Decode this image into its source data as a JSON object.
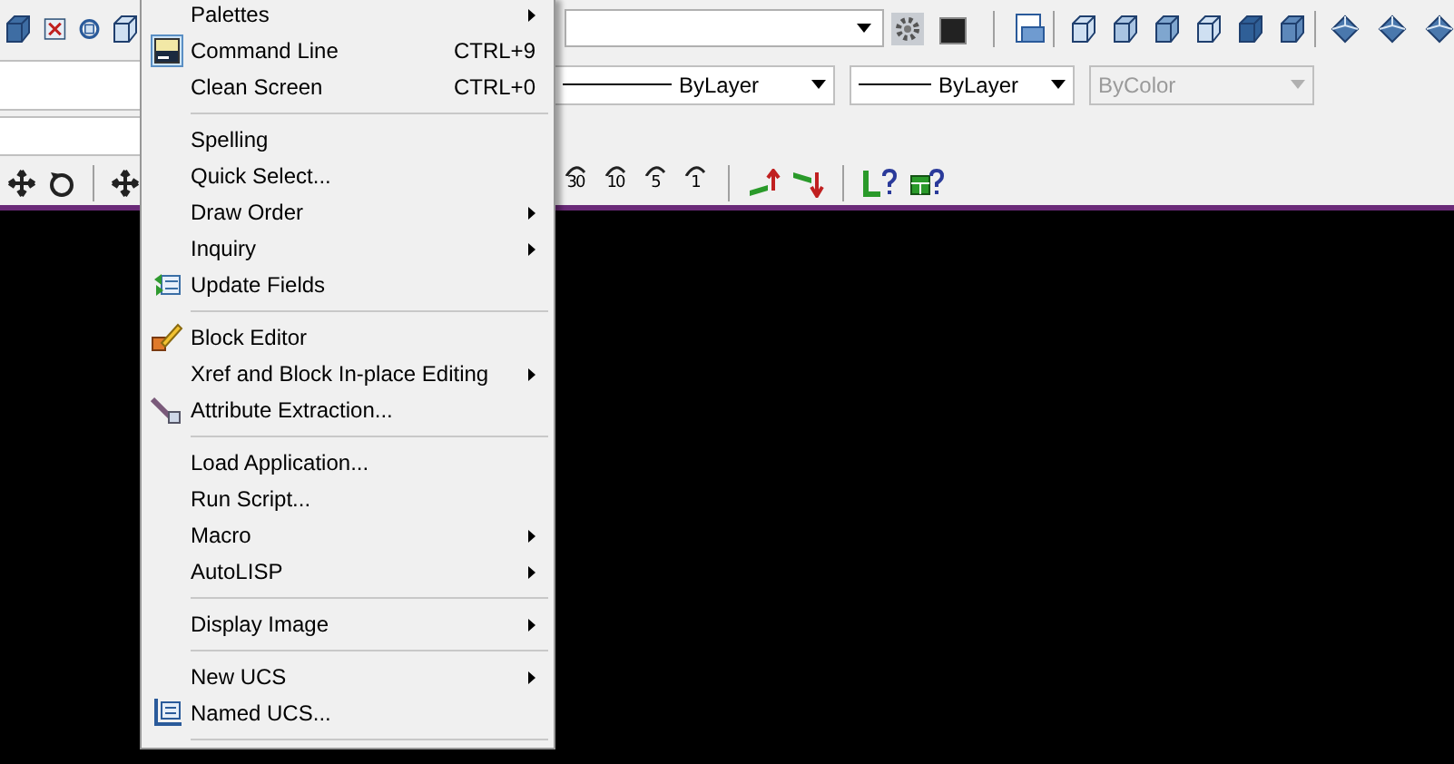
{
  "linetype_dropdowns": [
    {
      "value": "ByLayer",
      "disabled": false
    },
    {
      "value": "ByLayer",
      "disabled": false
    },
    {
      "value": "ByColor",
      "disabled": true
    }
  ],
  "rotate_buttons": [
    {
      "label": "30"
    },
    {
      "label": "10"
    },
    {
      "label": "5"
    },
    {
      "label": "1"
    }
  ],
  "menu": {
    "items": [
      {
        "kind": "item",
        "label": "Palettes",
        "submenu": true
      },
      {
        "kind": "item",
        "label": "Command Line",
        "shortcut": "CTRL+9",
        "submenu": false
      },
      {
        "kind": "item",
        "label": "Clean Screen",
        "shortcut": "CTRL+0",
        "submenu": false
      },
      {
        "kind": "separator"
      },
      {
        "kind": "item",
        "label": "Spelling",
        "submenu": false
      },
      {
        "kind": "item",
        "label": "Quick Select...",
        "submenu": false
      },
      {
        "kind": "item",
        "label": "Draw Order",
        "submenu": true
      },
      {
        "kind": "item",
        "label": "Inquiry",
        "submenu": true
      },
      {
        "kind": "item",
        "label": "Update Fields",
        "submenu": false
      },
      {
        "kind": "separator"
      },
      {
        "kind": "item",
        "label": "Block Editor",
        "submenu": false
      },
      {
        "kind": "item",
        "label": "Xref and Block In-place Editing",
        "submenu": true
      },
      {
        "kind": "item",
        "label": "Attribute Extraction...",
        "submenu": false
      },
      {
        "kind": "separator"
      },
      {
        "kind": "item",
        "label": "Load Application...",
        "submenu": false
      },
      {
        "kind": "item",
        "label": "Run Script...",
        "submenu": false
      },
      {
        "kind": "item",
        "label": "Macro",
        "submenu": true
      },
      {
        "kind": "item",
        "label": "AutoLISP",
        "submenu": true
      },
      {
        "kind": "separator"
      },
      {
        "kind": "item",
        "label": "Display Image",
        "submenu": true
      },
      {
        "kind": "separator"
      },
      {
        "kind": "item",
        "label": "New UCS",
        "submenu": true
      },
      {
        "kind": "item",
        "label": "Named UCS...",
        "submenu": false
      },
      {
        "kind": "separator"
      }
    ]
  }
}
